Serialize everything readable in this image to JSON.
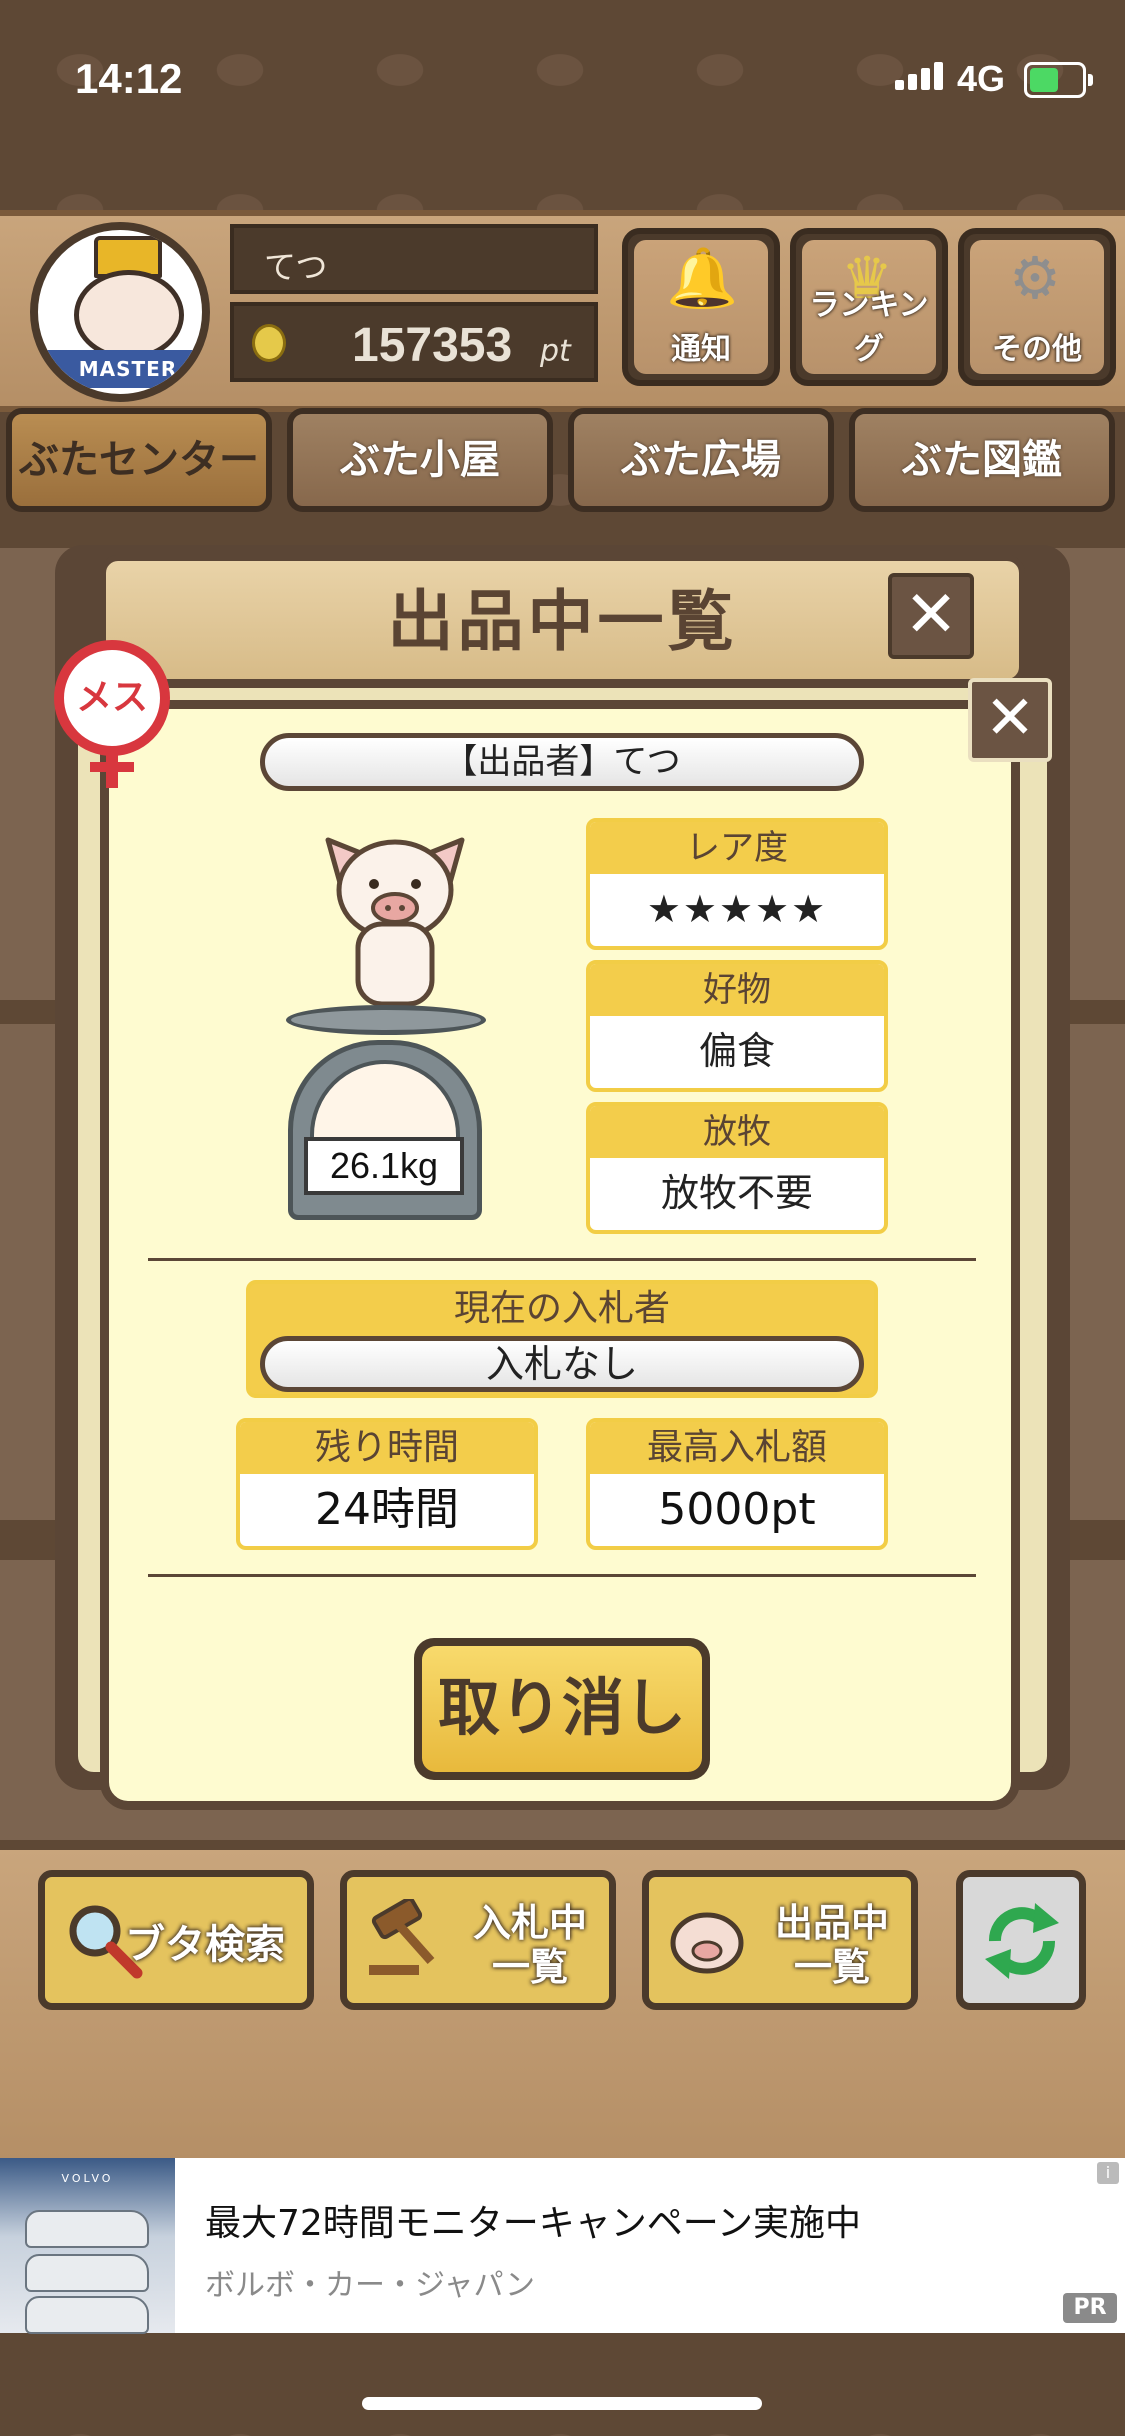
{
  "status_bar": {
    "time": "14:12",
    "network": "4G"
  },
  "header": {
    "badge_label": "MASTER",
    "user_name": "てつ",
    "points_value": "157353",
    "points_unit": "pt",
    "buttons": [
      {
        "label": "通知",
        "icon": "bell-icon"
      },
      {
        "label": "ランキング",
        "icon": "crown-icon"
      },
      {
        "label": "その他",
        "icon": "gear-icon"
      }
    ]
  },
  "tabs": [
    {
      "label": "ぶたセンター",
      "active": true
    },
    {
      "label": "ぶた小屋",
      "active": false
    },
    {
      "label": "ぶた広場",
      "active": false
    },
    {
      "label": "ぶた図鑑",
      "active": false
    }
  ],
  "modal": {
    "title": "出品中一覧",
    "close_glyph": "✕",
    "gender_label": "メス",
    "seller": "【出品者】てつ",
    "weight": "26.1kg",
    "info": [
      {
        "header": "レア度",
        "value": "★★★★★",
        "stars": 5
      },
      {
        "header": "好物",
        "value": "偏食"
      },
      {
        "header": "放牧",
        "value": "放牧不要"
      }
    ],
    "current_bidder_header": "現在の入札者",
    "current_bidder_value": "入札なし",
    "remaining_time_header": "残り時間",
    "remaining_time_value": "24時間",
    "highest_bid_header": "最高入札額",
    "highest_bid_value": "5000pt",
    "cancel_label": "取り消し"
  },
  "bottom_buttons": [
    {
      "label": "ブタ検索",
      "icon": "magnifier-icon"
    },
    {
      "label": "入札中\n一覧",
      "icon": "gavel-icon"
    },
    {
      "label": "出品中\n一覧",
      "icon": "pig-icon"
    },
    {
      "label": "",
      "icon": "refresh-icon"
    }
  ],
  "ad": {
    "brand_label": "VOLVO",
    "headline": "最大72時間モニターキャンペーン実施中",
    "advertiser": "ボルボ・カー・ジャパン",
    "pr_label": "PR",
    "info_glyph": "i"
  },
  "colors": {
    "accent_yellow": "#f3cd4b",
    "wood_dark": "#4b3a2b",
    "card_cream": "#fefbd0",
    "female_red": "#d8373e",
    "star_pink": "#de7b78"
  }
}
